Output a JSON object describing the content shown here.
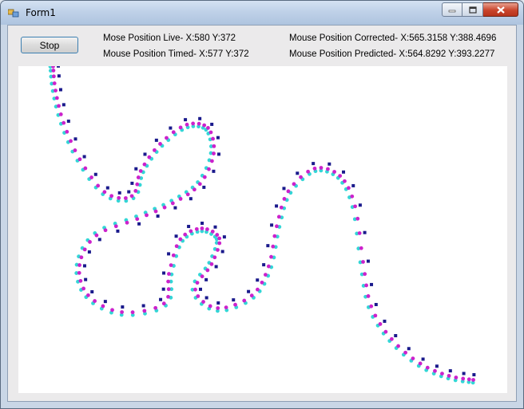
{
  "window": {
    "title": "Form1"
  },
  "controls": {
    "stop_label": "Stop"
  },
  "readouts": {
    "live": "Mose Position Live- X:580 Y:372",
    "timed": "Mouse Position Timed- X:577 Y:372",
    "corrected": "Mouse Position Corrected- X:565.3158 Y:388.4696",
    "predicted": "Mouse Position Predicted- X:564.8292 Y:393.2277"
  },
  "colors": {
    "live": "#1a1a8c",
    "corrected": "#cc22cc",
    "predicted": "#33d6d6"
  }
}
